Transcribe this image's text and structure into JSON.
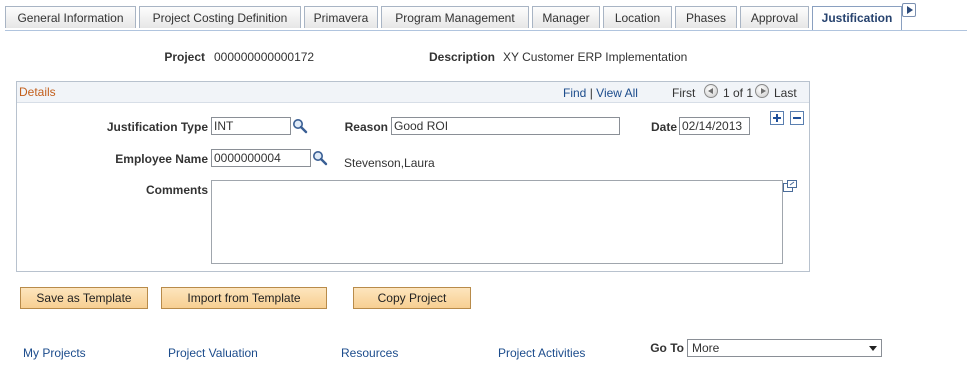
{
  "tabs": [
    {
      "label": "General Information",
      "active": false
    },
    {
      "label": "Project Costing Definition",
      "active": false
    },
    {
      "label": "Primavera",
      "active": false
    },
    {
      "label": "Program Management",
      "active": false
    },
    {
      "label": "Manager",
      "active": false
    },
    {
      "label": "Location",
      "active": false
    },
    {
      "label": "Phases",
      "active": false
    },
    {
      "label": "Approval",
      "active": false
    },
    {
      "label": "Justification",
      "active": true
    }
  ],
  "header": {
    "project_label": "Project",
    "project_value": "000000000000172",
    "description_label": "Description",
    "description_value": "XY Customer ERP Implementation"
  },
  "details": {
    "title": "Details",
    "find": "Find",
    "separator": "|",
    "view_all": "View All",
    "first": "First",
    "paging": "1 of 1",
    "last": "Last",
    "justification_type_label": "Justification Type",
    "justification_type_value": "INT",
    "reason_label": "Reason",
    "reason_value": "Good ROI",
    "date_label": "Date",
    "date_value": "02/14/2013",
    "employee_name_label": "Employee Name",
    "employee_name_value": "0000000004",
    "employee_display_name": "Stevenson,Laura",
    "comments_label": "Comments",
    "comments_value": ""
  },
  "buttons": {
    "save_as_template": "Save as Template",
    "import_from_template": "Import from Template",
    "copy_project": "Copy Project"
  },
  "footer_links": {
    "my_projects": "My Projects",
    "project_valuation": "Project Valuation",
    "resources": "Resources",
    "project_activities": "Project Activities"
  },
  "goto": {
    "label": "Go To",
    "selected": "More"
  },
  "colors": {
    "accent_link": "#1c4c8c",
    "section_title": "#c35f1c",
    "button_fill": "#f7cf92"
  }
}
